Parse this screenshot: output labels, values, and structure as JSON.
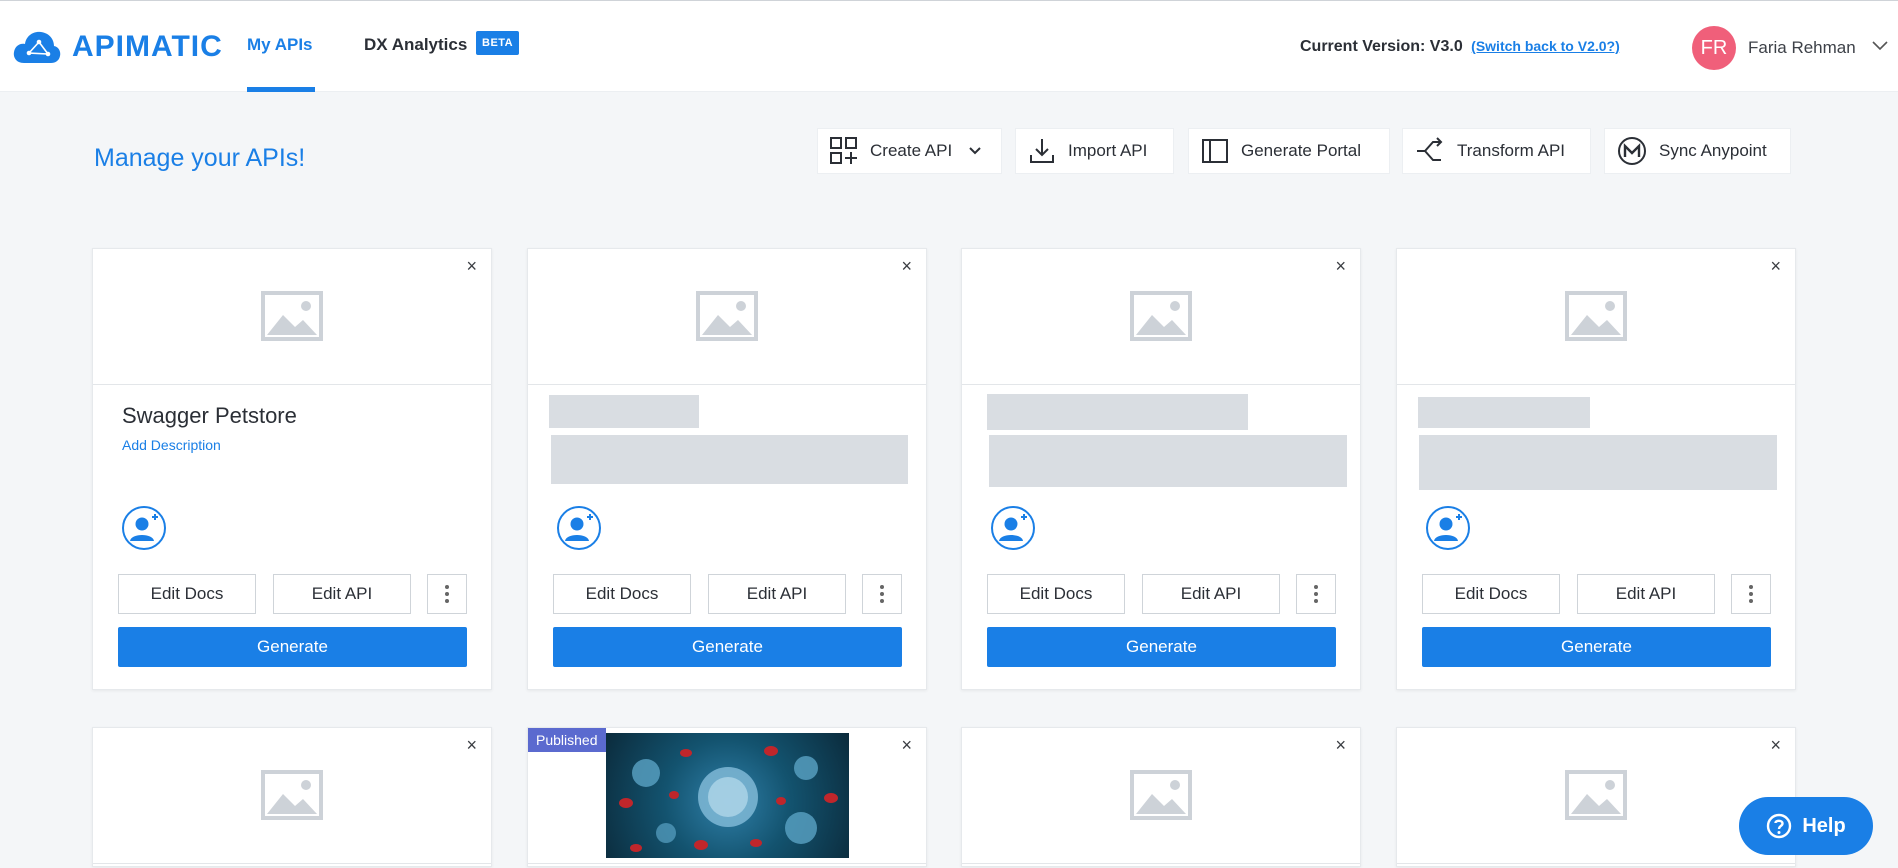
{
  "header": {
    "brand": "APIMATIC",
    "nav": [
      {
        "label": "My APIs"
      },
      {
        "label": "DX Analytics"
      }
    ],
    "beta_badge": "BETA",
    "version_prefix": "Current Version: V3.0",
    "version_switch_link": "(Switch back to V2.0?)",
    "user": {
      "initials": "FR",
      "name": "Faria Rehman",
      "avatar_color": "#f05f7a"
    },
    "accent_color": "#1a7fe6"
  },
  "page": {
    "title": "Manage your APIs!",
    "actions": [
      {
        "label": "Create API",
        "icon": "grid-add-icon",
        "has_dropdown": true
      },
      {
        "label": "Import API",
        "icon": "download-icon"
      },
      {
        "label": "Generate Portal",
        "icon": "portal-layout-icon"
      },
      {
        "label": "Transform API",
        "icon": "transform-split-icon"
      },
      {
        "label": "Sync Anypoint",
        "icon": "mulesoft-icon"
      }
    ]
  },
  "cards": [
    {
      "title": "Swagger Petstore",
      "description_link": "Add Description",
      "loading": false
    },
    {
      "title": null,
      "loading": true
    },
    {
      "title": null,
      "loading": true
    },
    {
      "title": null,
      "loading": true
    }
  ],
  "card_labels": {
    "edit_docs": "Edit Docs",
    "edit_api": "Edit API",
    "generate": "Generate",
    "close": "×"
  },
  "second_row": [
    {
      "published": false
    },
    {
      "published": true,
      "badge": "Published",
      "image": "virus-illustration"
    },
    {
      "published": false
    },
    {
      "published": false
    }
  ],
  "help": {
    "label": "Help"
  }
}
